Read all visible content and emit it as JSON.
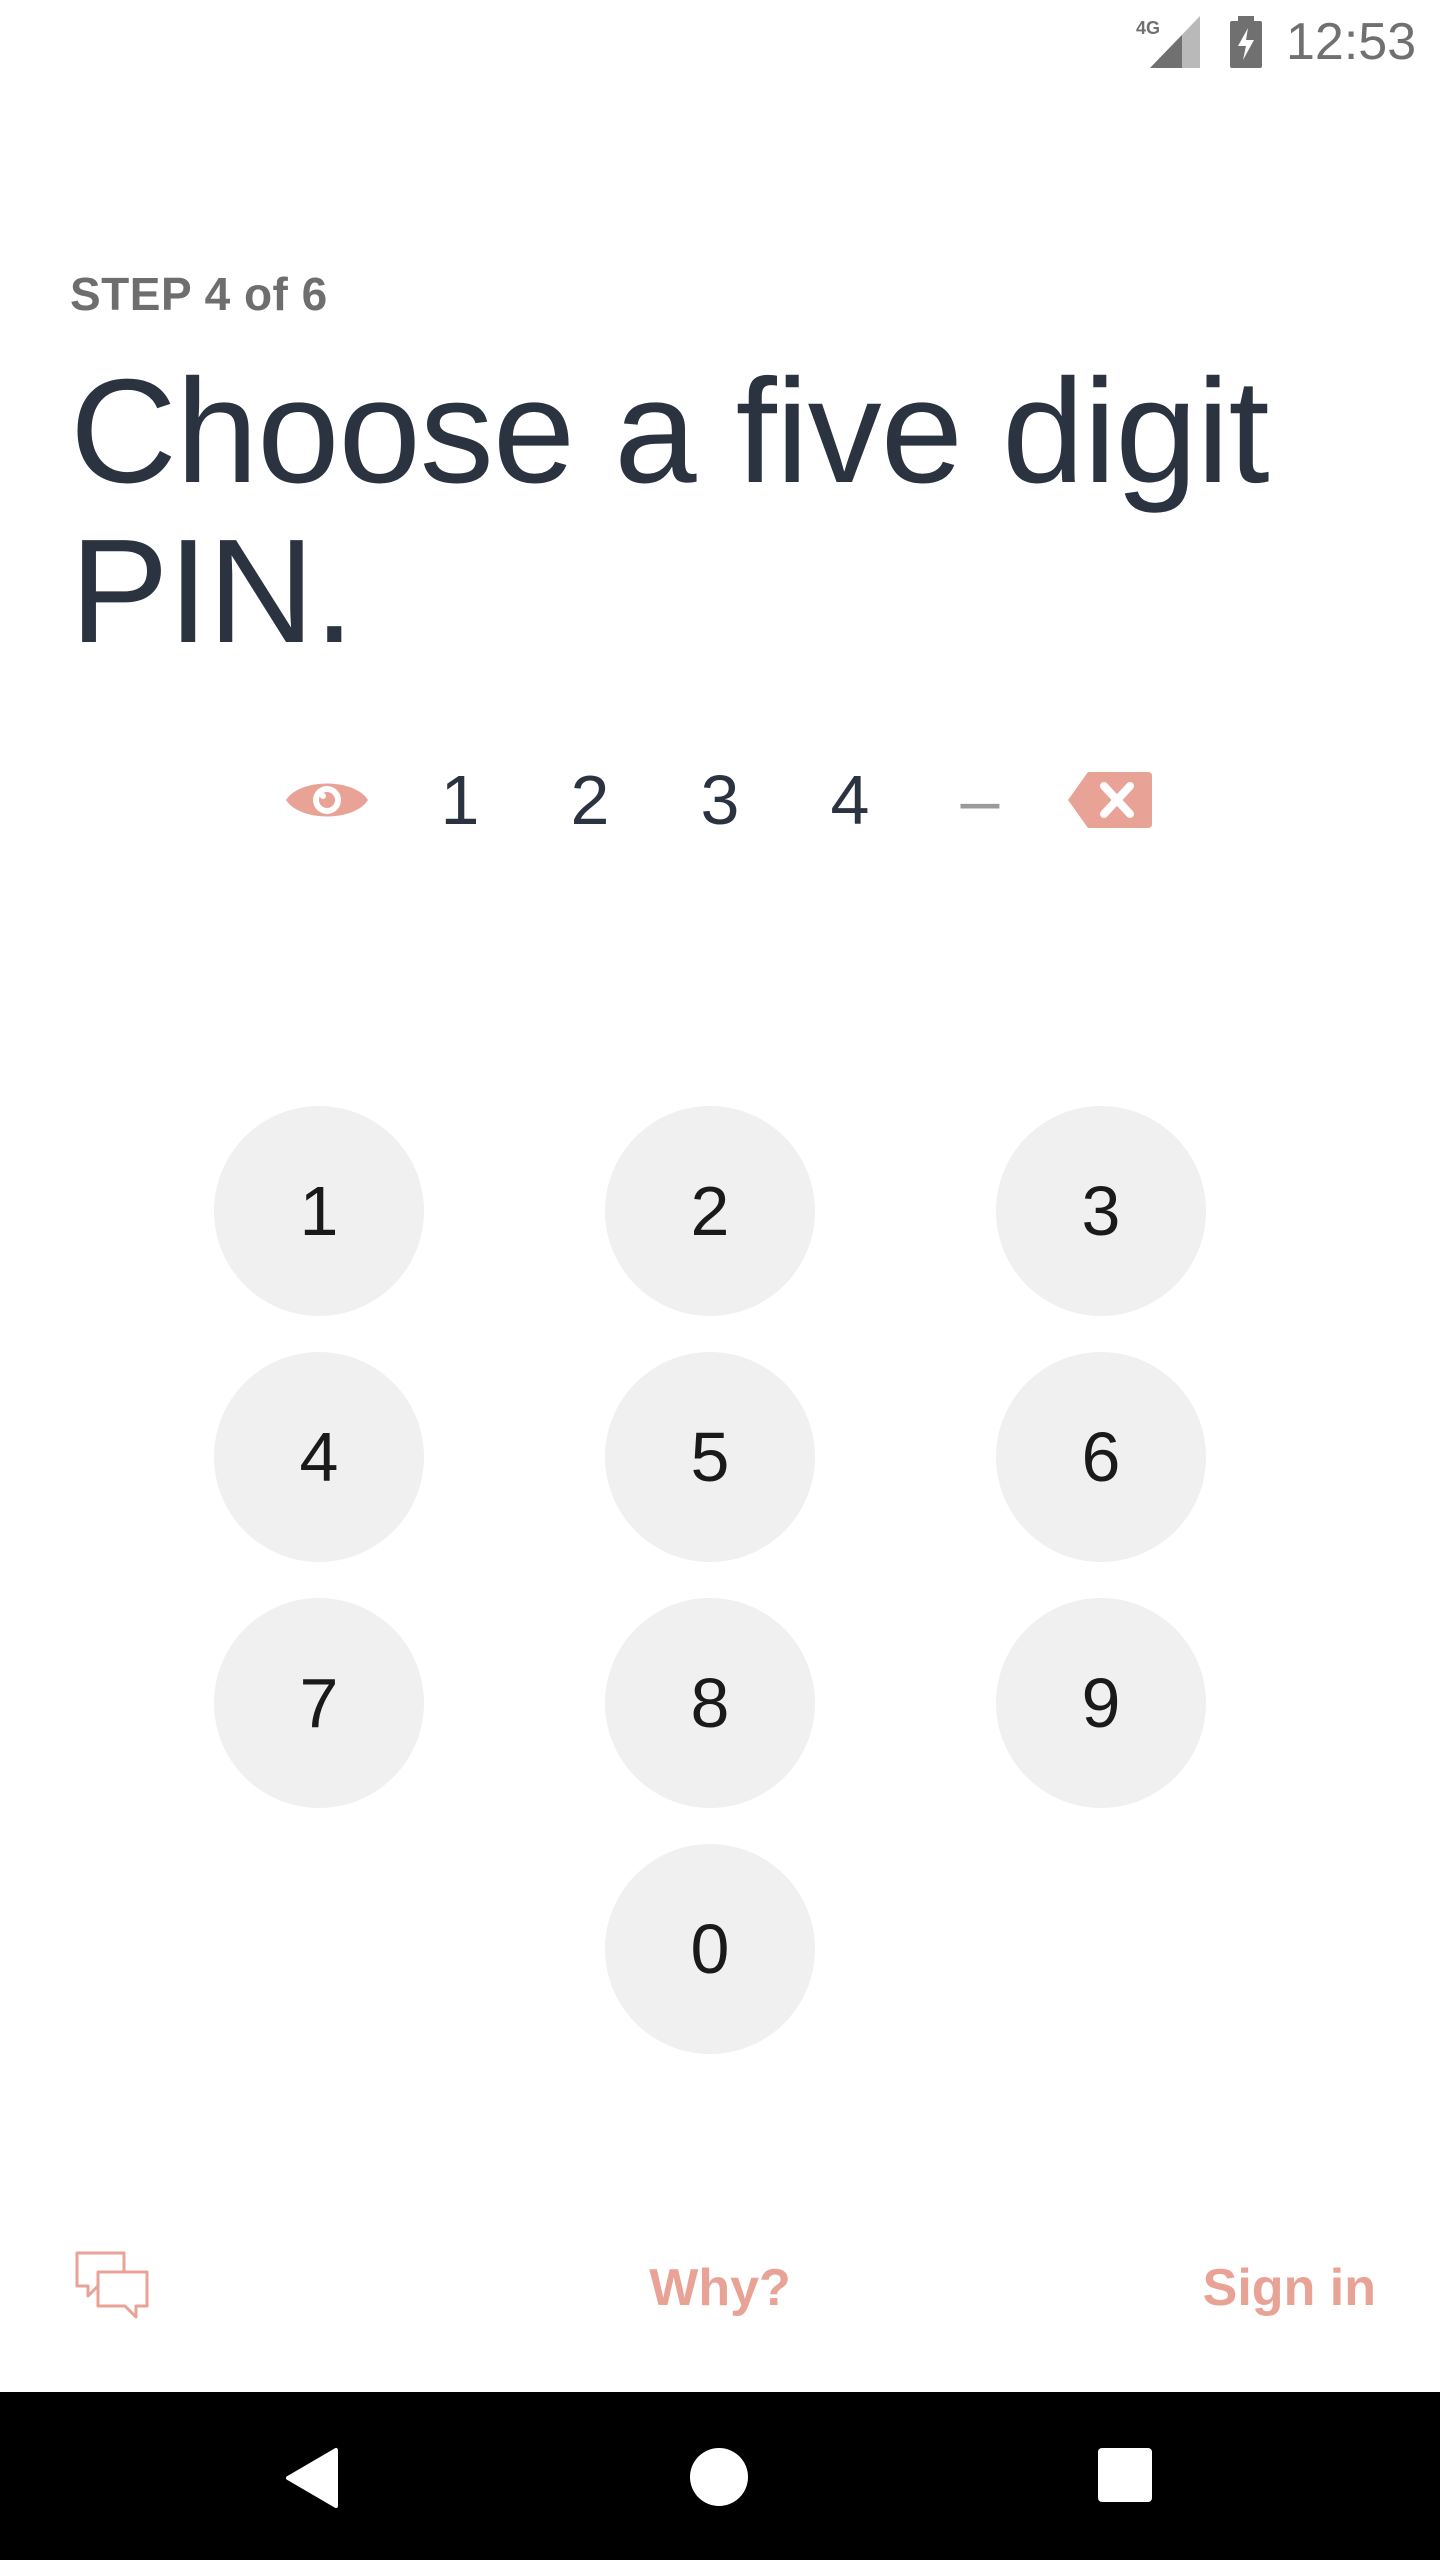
{
  "status_bar": {
    "network": "4G",
    "time": "12:53",
    "signal_icon": "cell-signal-icon",
    "battery_icon": "battery-charging-icon"
  },
  "step": {
    "label": "STEP 4 of 6"
  },
  "title": "Choose a five digit PIN.",
  "pin": {
    "digits": [
      "1",
      "2",
      "3",
      "4",
      "–"
    ],
    "toggle_icon": "eye-icon",
    "clear_icon": "backspace-icon"
  },
  "keypad": {
    "keys": [
      "1",
      "2",
      "3",
      "4",
      "5",
      "6",
      "7",
      "8",
      "9",
      "0"
    ]
  },
  "footer": {
    "chat_icon": "chat-bubbles-icon",
    "why_label": "Why?",
    "signin_label": "Sign in"
  },
  "nav_bar": {
    "back_icon": "back-triangle-icon",
    "home_icon": "home-circle-icon",
    "recents_icon": "recents-square-icon"
  },
  "colors": {
    "accent": "#e8a396",
    "text_dark": "#2c3340",
    "key_background": "#f0f0f0",
    "step_label": "#6e6e6e"
  }
}
